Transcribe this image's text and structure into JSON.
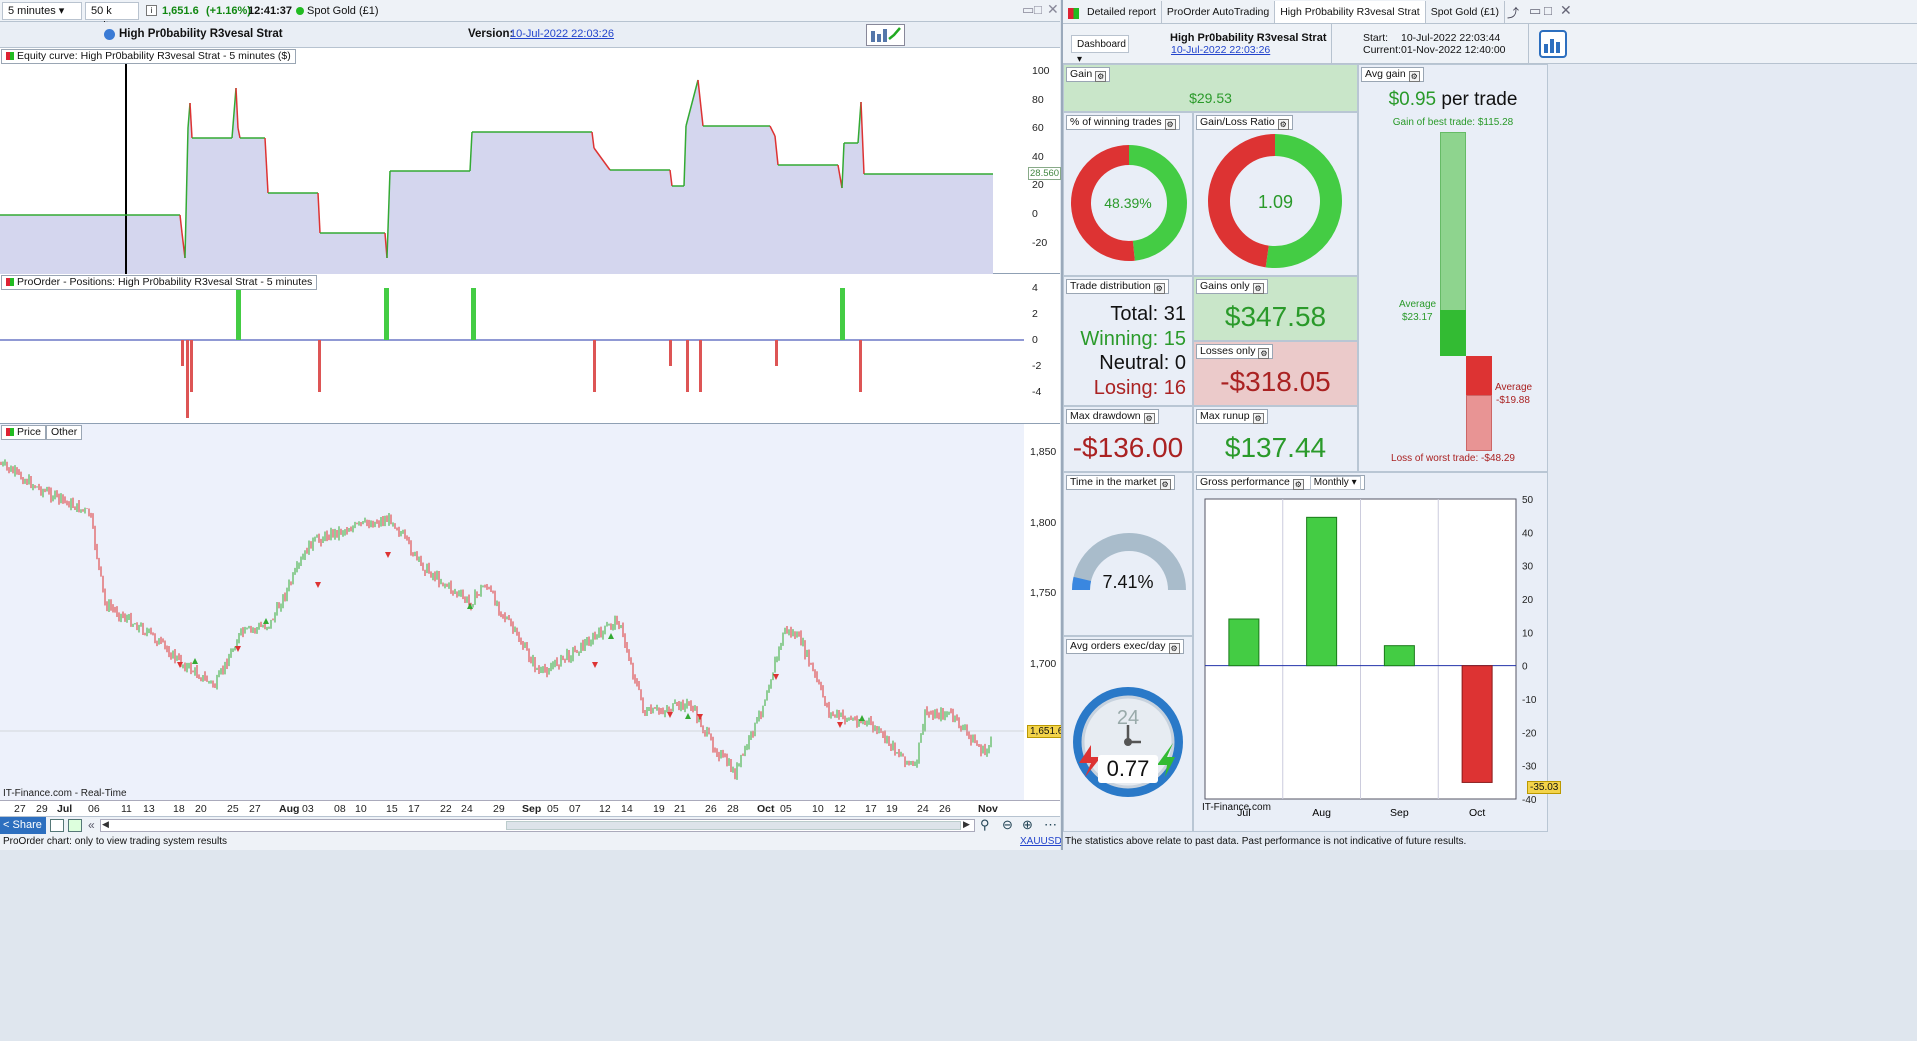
{
  "left_toolbar": {
    "timeframe": "5 minutes",
    "units": "50 k units",
    "price": "1,651.6",
    "change": "(+1.16%)",
    "time": "12:41:37",
    "instrument": "Spot Gold (£1)"
  },
  "strategy_bar": {
    "name": "High Pr0bability R3vesal Strat",
    "version_label": "Version:",
    "version_date": "10-Jul-2022 22:03:26"
  },
  "equity_panel": {
    "title": "Equity curve: High Pr0bability R3vesal Strat - 5 minutes ($)",
    "y_ticks": [
      "100",
      "80",
      "60",
      "40",
      "20",
      "0",
      "-20"
    ],
    "current_value": "28.560"
  },
  "positions_panel": {
    "title": "ProOrder - Positions: High Pr0bability R3vesal Strat - 5 minutes",
    "y_ticks": [
      "4",
      "2",
      "0",
      "-2",
      "-4"
    ]
  },
  "price_panel": {
    "tab_price": "Price",
    "tab_other": "Other",
    "y_ticks": [
      "1,850",
      "1,800",
      "1,750",
      "1,700"
    ],
    "current_price": "1,651.6",
    "watermark": "IT-Finance.com - Real-Time",
    "x_ticks": [
      "27",
      "29",
      "Jul",
      "06",
      "11",
      "13",
      "18",
      "20",
      "25",
      "27",
      "Aug",
      "03",
      "08",
      "10",
      "15",
      "17",
      "22",
      "24",
      "29",
      "Sep",
      "05",
      "07",
      "12",
      "14",
      "19",
      "21",
      "26",
      "28",
      "Oct",
      "05",
      "10",
      "12",
      "17",
      "19",
      "24",
      "26",
      "Nov"
    ]
  },
  "left_bottom": {
    "share": "Share",
    "status": "ProOrder chart: only to view trading system results",
    "symbol": "XAUUSD"
  },
  "right_tabs": [
    "Detailed report",
    "ProOrder AutoTrading",
    "High Pr0bability R3vesal Strat",
    "Spot Gold (£1)"
  ],
  "report_header": {
    "dashboard": "Dashboard",
    "name": "High Pr0bability R3vesal Strat",
    "date": "10-Jul-2022 22:03:26",
    "start_label": "Start:",
    "start": "10-Jul-2022 22:03:44",
    "current_label": "Current:",
    "current": "01-Nov-2022 12:40:00"
  },
  "stats": {
    "gain_label": "Gain",
    "gain": "$29.53",
    "avg_gain_label": "Avg gain",
    "avg_gain": "$0.95",
    "per_trade": "per trade",
    "best_trade": "Gain of best trade: $115.28",
    "worst_trade": "Loss of worst trade: -$48.29",
    "avg_win_label": "Average",
    "avg_win": "$23.17",
    "avg_loss_label": "Average",
    "avg_loss": "-$19.88",
    "win_pct_label": "% of winning trades",
    "win_pct": "48.39%",
    "gl_ratio_label": "Gain/Loss Ratio",
    "gl_ratio": "1.09",
    "trade_dist_label": "Trade distribution",
    "total": "Total: 31",
    "winning": "Winning: 15",
    "neutral": "Neutral: 0",
    "losing": "Losing: 16",
    "gains_only_label": "Gains only",
    "gains_only": "$347.58",
    "losses_only_label": "Losses only",
    "losses_only": "-$318.05",
    "max_dd_label": "Max drawdown",
    "max_dd": "-$136.00",
    "max_runup_label": "Max runup",
    "max_runup": "$137.44",
    "time_market_label": "Time in the market",
    "time_market": "7.41%",
    "avg_orders_label": "Avg orders exec/day",
    "avg_orders": "0.77",
    "clock_num": "24",
    "gross_label": "Gross performance",
    "gross_period": "Monthly",
    "gross_watermark": "IT-Finance.com",
    "gross_last": "-35.03"
  },
  "colors": {
    "green": "#33bb33",
    "red": "#dd3333",
    "equity_fill": "#d4d6ee",
    "bg_panel": "#e4eaf6"
  },
  "chart_data": [
    {
      "type": "bar",
      "title": "Gross performance",
      "categories": [
        "Jul",
        "Aug",
        "Sep",
        "Oct"
      ],
      "values": [
        14,
        44.5,
        6,
        -35.03
      ],
      "ylim": [
        -40,
        50
      ],
      "y_ticks": [
        50,
        40,
        30,
        20,
        10,
        0,
        -10,
        -20,
        -30,
        -40
      ]
    },
    {
      "type": "pie",
      "title": "% of winning trades",
      "values": [
        48.39,
        51.61
      ]
    },
    {
      "type": "pie",
      "title": "Gain/Loss Ratio",
      "values": [
        347.58,
        318.05
      ]
    }
  ],
  "footer_note": "The statistics above relate to past data. Past performance is not indicative of future results."
}
